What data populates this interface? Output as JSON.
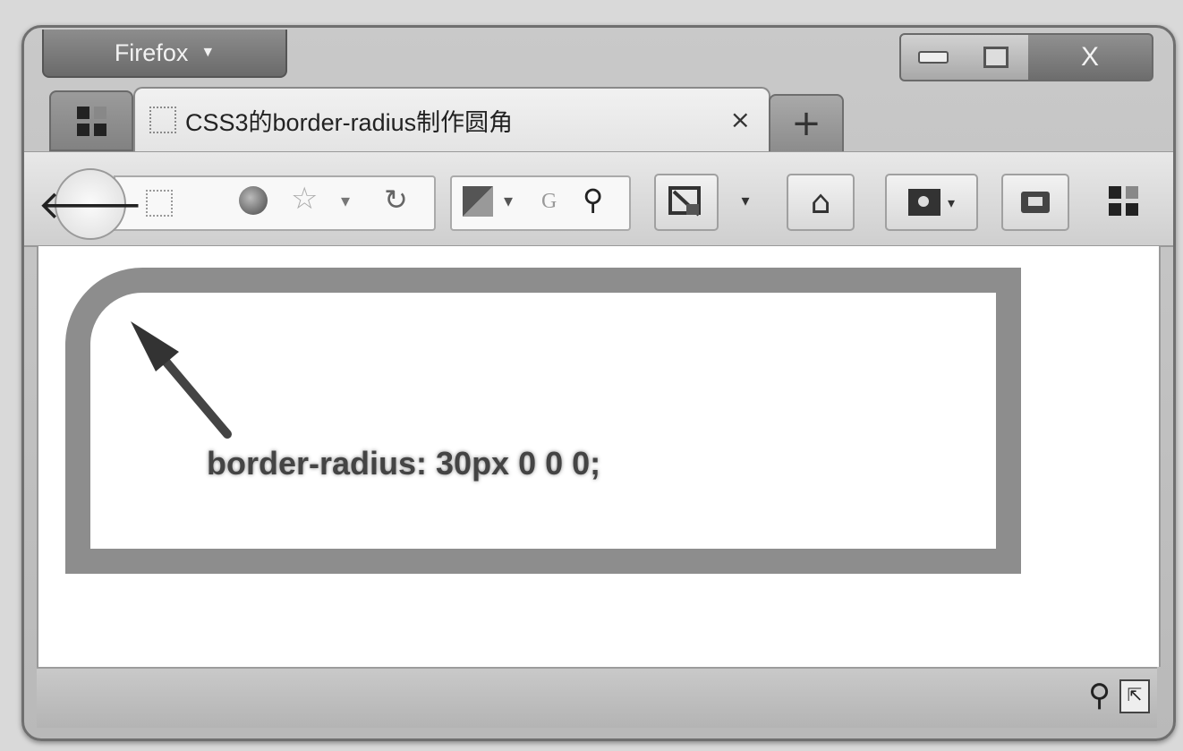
{
  "window": {
    "app_menu_label": "Firefox",
    "close_label": "X"
  },
  "tab": {
    "title": "CSS3的border-radius制作圆角",
    "close_glyph": "×",
    "new_tab_glyph": "+"
  },
  "toolbar": {
    "back_glyph": "🡐",
    "star_glyph": "☆",
    "dropdown_glyph": "▾",
    "reload_glyph": "↻",
    "search_engine_letter": "G",
    "search_glyph": "⚲",
    "home_glyph": "⌂"
  },
  "page": {
    "demo_label": "border-radius: 30px 0 0 0;"
  },
  "statusbar": {
    "zoom_glyph": "⚲",
    "resize_glyph": "⇱"
  },
  "icons": [
    "tab-groups-icon",
    "page-icon",
    "back-arrow-icon",
    "site-identity-icon",
    "globe-icon",
    "star-icon",
    "history-dropdown-icon",
    "reload-icon",
    "search-engine-icon",
    "search-icon",
    "developer-tools-icon",
    "home-icon",
    "bookmarks-icon",
    "mail-icon",
    "apps-icon",
    "zoom-icon",
    "resize-icon"
  ]
}
